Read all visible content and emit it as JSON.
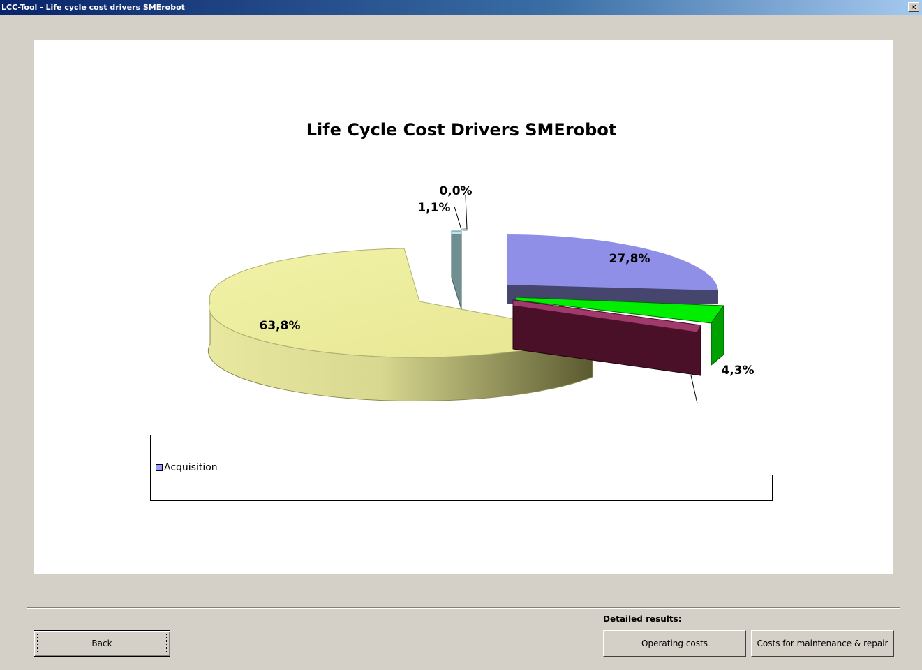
{
  "window": {
    "title": "LCC-Tool  -  Life cycle cost drivers SMErobot",
    "close_glyph": "✕"
  },
  "chart_data": {
    "type": "pie",
    "title": "Life Cycle Cost Drivers SMErobot",
    "slices": [
      {
        "label": "27,8%",
        "value": 27.8,
        "color": "#9999ff"
      },
      {
        "label": "4,3%",
        "value": 4.3,
        "color": "#00ff00"
      },
      {
        "label": "",
        "value": 3.0,
        "color": "#993366"
      },
      {
        "label": "63,8%",
        "value": 63.8,
        "color": "#ffff99"
      },
      {
        "label": "1,1%",
        "value": 1.1,
        "color": "#6699aa"
      },
      {
        "label": "0,0%",
        "value": 0.0,
        "color": "#ccffff"
      }
    ],
    "legend": {
      "visible_item": "Acquisition",
      "visible_item_color": "#9999ff"
    }
  },
  "footer": {
    "detailed_label": "Detailed results:",
    "back_label": "Back",
    "operating_label": "Operating costs",
    "maintenance_label": "Costs for maintenance & repair"
  }
}
